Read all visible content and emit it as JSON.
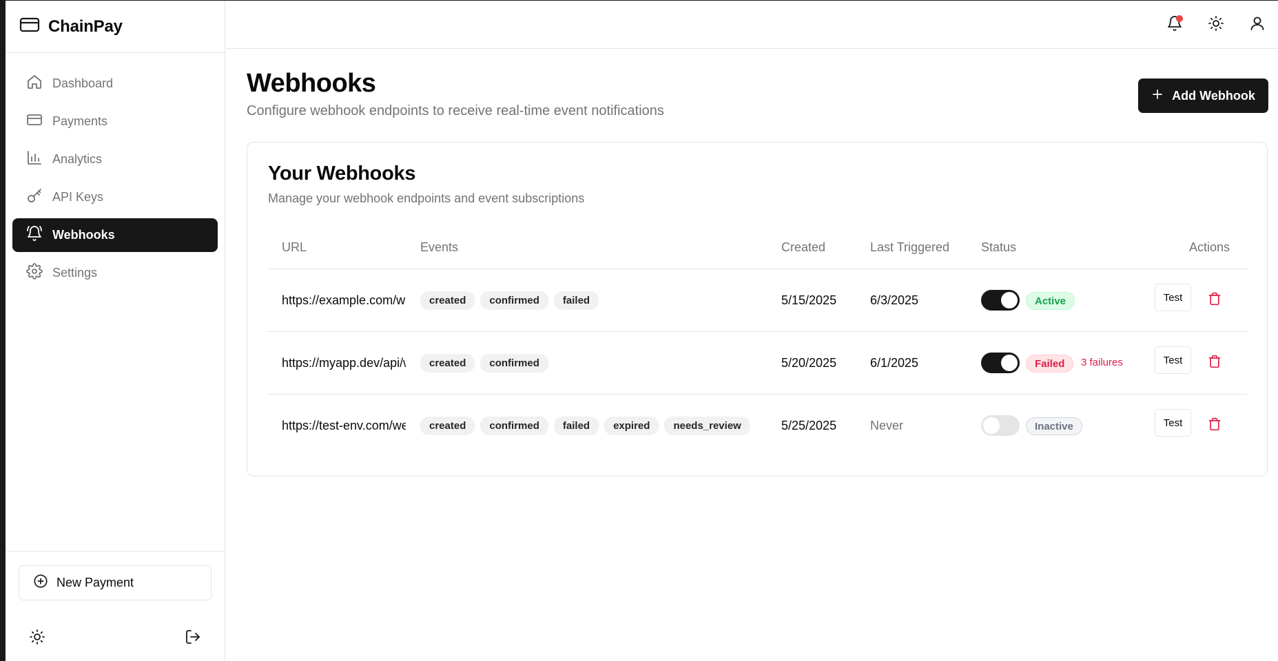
{
  "app": {
    "name": "ChainPay"
  },
  "sidebar": {
    "items": [
      {
        "label": "Dashboard",
        "icon": "home-icon"
      },
      {
        "label": "Payments",
        "icon": "credit-card-icon"
      },
      {
        "label": "Analytics",
        "icon": "bar-chart-icon"
      },
      {
        "label": "API Keys",
        "icon": "key-icon"
      },
      {
        "label": "Webhooks",
        "icon": "bell-icon",
        "active": true
      },
      {
        "label": "Settings",
        "icon": "gear-icon"
      }
    ],
    "new_payment_label": "New Payment"
  },
  "page": {
    "title": "Webhooks",
    "subtitle": "Configure webhook endpoints to receive real-time event notifications",
    "add_button_label": "Add Webhook"
  },
  "card": {
    "title": "Your Webhooks",
    "subtitle": "Manage your webhook endpoints and event subscriptions"
  },
  "table": {
    "headers": [
      "URL",
      "Events",
      "Created",
      "Last Triggered",
      "Status",
      "Actions"
    ],
    "rows": [
      {
        "url": "https://example.com/webhook",
        "events": [
          "created",
          "confirmed",
          "failed"
        ],
        "created": "5/15/2025",
        "last_triggered": "6/3/2025",
        "enabled": true,
        "status": "Active",
        "failures": "",
        "test_label": "Test"
      },
      {
        "url": "https://myapp.dev/api/webhook",
        "events": [
          "created",
          "confirmed"
        ],
        "created": "5/20/2025",
        "last_triggered": "6/1/2025",
        "enabled": true,
        "status": "Failed",
        "failures": "3 failures",
        "test_label": "Test"
      },
      {
        "url": "https://test-env.com/webhook",
        "events": [
          "created",
          "confirmed",
          "failed",
          "expired",
          "needs_review"
        ],
        "created": "5/25/2025",
        "last_triggered": "Never",
        "enabled": false,
        "status": "Inactive",
        "failures": "",
        "test_label": "Test"
      }
    ]
  },
  "colors": {
    "primary": "#171717",
    "active_green": "#16a34a",
    "failed_red": "#e11d48",
    "notification_dot": "#ef4444"
  }
}
